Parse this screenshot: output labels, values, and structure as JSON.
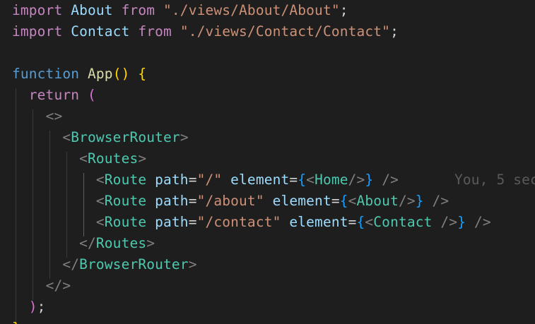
{
  "editor": {
    "lines": [
      {
        "parts": [
          "import",
          " ",
          "About",
          " ",
          "from",
          " ",
          "\"./views/About/About\"",
          ";"
        ]
      },
      {
        "parts": [
          "import",
          " ",
          "Contact",
          " ",
          "from",
          " ",
          "\"./views/Contact/Contact\"",
          ";"
        ]
      },
      {
        "parts": []
      },
      {
        "parts": [
          "function",
          " ",
          "App",
          "(",
          ")",
          " ",
          "{"
        ]
      },
      {
        "parts": [
          "  ",
          "return",
          " ",
          "("
        ]
      },
      {
        "parts": [
          "    ",
          "<>"
        ]
      },
      {
        "parts": [
          "      ",
          "<",
          "BrowserRouter",
          ">"
        ]
      },
      {
        "parts": [
          "        ",
          "<",
          "Routes",
          ">"
        ]
      },
      {
        "parts": [
          "          ",
          "<",
          "Route",
          " ",
          "path",
          "=",
          "\"/\"",
          " ",
          "element",
          "=",
          "{",
          "<",
          "Home",
          "/>",
          "}",
          " ",
          "/>"
        ]
      },
      {
        "parts": [
          "          ",
          "<",
          "Route",
          " ",
          "path",
          "=",
          "\"/about\"",
          " ",
          "element",
          "=",
          "{",
          "<",
          "About",
          "/>",
          "}",
          " ",
          "/>"
        ]
      },
      {
        "parts": [
          "          ",
          "<",
          "Route",
          " ",
          "path",
          "=",
          "\"/contact\"",
          " ",
          "element",
          "=",
          "{",
          "<",
          "Contact",
          " ",
          "/>",
          "}",
          " ",
          "/>"
        ]
      },
      {
        "parts": [
          "        ",
          "</",
          "Routes",
          ">"
        ]
      },
      {
        "parts": [
          "      ",
          "</",
          "BrowserRouter",
          ">"
        ]
      },
      {
        "parts": [
          "    ",
          "</>"
        ]
      },
      {
        "parts": [
          "  ",
          ")",
          ";"
        ]
      },
      {
        "parts": [
          "}"
        ]
      }
    ],
    "blame": "You, 5 sec"
  },
  "colors": {
    "background": "#1e1e1e",
    "keyword_import": "#c586c0",
    "keyword": "#569cd6",
    "identifier": "#9cdcfe",
    "string": "#ce9178",
    "function": "#dcdcaa",
    "jsx_tag": "#4ec9b0",
    "angle_bracket": "#808080",
    "bracket_gold": "#ffd700",
    "bracket_pink": "#da70d6",
    "bracket_blue": "#179fff"
  }
}
